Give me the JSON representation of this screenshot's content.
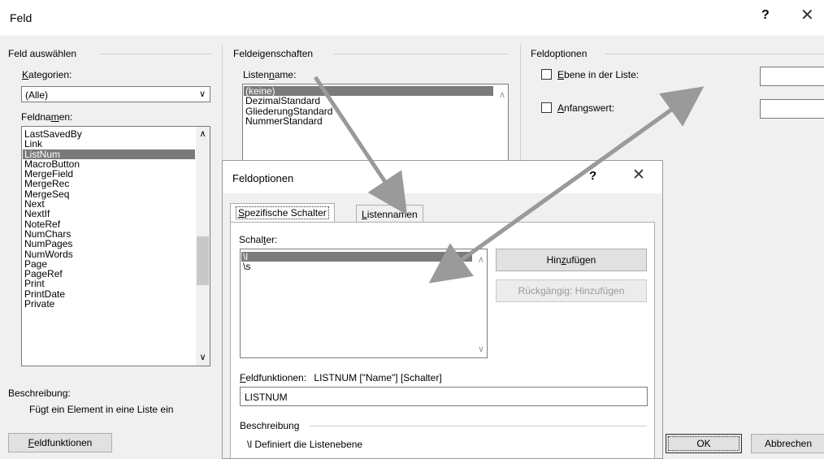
{
  "titlebar": {
    "title": "Feld",
    "help": "?",
    "close": "✕"
  },
  "select_field": {
    "header": "Feld auswählen",
    "categories_label_pre": "",
    "categories_label_u": "K",
    "categories_label_post": "ategorien:",
    "categories_value": "(Alle)",
    "fieldnames_label_pre": "Feldna",
    "fieldnames_label_u": "m",
    "fieldnames_label_post": "en:",
    "fieldnames": [
      "LastSavedBy",
      "Link",
      "ListNum",
      "MacroButton",
      "MergeField",
      "MergeRec",
      "MergeSeq",
      "Next",
      "NextIf",
      "NoteRef",
      "NumChars",
      "NumPages",
      "NumWords",
      "Page",
      "PageRef",
      "Print",
      "PrintDate",
      "Private"
    ],
    "selected": "ListNum"
  },
  "properties": {
    "header": "Feldeigenschaften",
    "listname_label_pre": "Listen",
    "listname_label_u": "n",
    "listname_label_post": "ame:",
    "listnames": [
      "(keine)",
      "DezimalStandard",
      "GliederungStandard",
      "NummerStandard"
    ],
    "selected": "(keine)"
  },
  "options": {
    "header": "Feldoptionen",
    "level_u": "E",
    "level_rest": "bene in der Liste:",
    "start_u": "A",
    "start_rest": "nfangswert:"
  },
  "description": {
    "label": "Beschreibung:",
    "text": "Fügt ein Element in eine Liste ein"
  },
  "field_codes_button_u": "F",
  "field_codes_button_rest": "eldfunktionen",
  "ok": "OK",
  "cancel": "Abbrechen",
  "subdialog": {
    "title": "Feldoptionen",
    "help": "?",
    "close": "✕",
    "tab1_u": "S",
    "tab1_rest": "pezifische Schalter",
    "tab2_u": "L",
    "tab2_rest": "istennamen",
    "switches_label_pre": "Schal",
    "switches_label_u": "t",
    "switches_label_post": "er:",
    "switches": [
      "\\l",
      "\\s"
    ],
    "add_pre": "Hin",
    "add_u": "z",
    "add_post": "ufügen",
    "undo_add": "Rückgängig: Hinzufügen",
    "codes_label_u": "F",
    "codes_label_rest": "eldfunktionen:",
    "codes_syntax": "LISTNUM [\"Name\"] [Schalter]",
    "codes_value": "LISTNUM",
    "desc_header": "Beschreibung",
    "desc_text": "\\l Definiert die Listenebene"
  },
  "colors": {
    "selection": "#7a7a7a",
    "arrow": "#9a9a9a"
  }
}
